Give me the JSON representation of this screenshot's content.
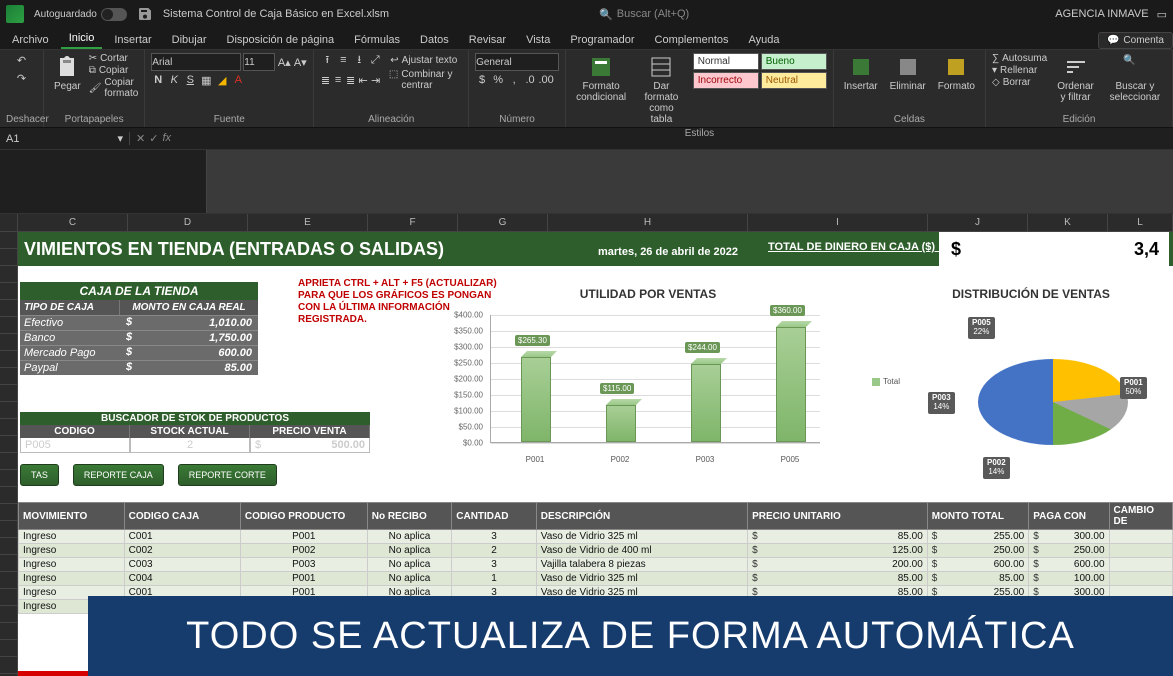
{
  "titlebar": {
    "autosave": "Autoguardado",
    "docname": "Sistema Control de Caja Básico en Excel.xlsm",
    "search": "Buscar (Alt+Q)",
    "account": "AGENCIA INMAVE"
  },
  "tabs": [
    "Archivo",
    "Inicio",
    "Insertar",
    "Dibujar",
    "Disposición de página",
    "Fórmulas",
    "Datos",
    "Revisar",
    "Vista",
    "Programador",
    "Complementos",
    "Ayuda"
  ],
  "active_tab": 1,
  "comments_btn": "Comenta",
  "ribbon": {
    "undo": "Deshacer",
    "paste": "Pegar",
    "cut": "Cortar",
    "copy": "Copiar",
    "fmtpaint": "Copiar formato",
    "clipboard": "Portapapeles",
    "font_name": "Arial",
    "font_size": "11",
    "font": "Fuente",
    "wrap": "Ajustar texto",
    "merge": "Combinar y centrar",
    "align": "Alineación",
    "numfmt": "General",
    "number": "Número",
    "condfmt": "Formato condicional",
    "astable": "Dar formato como tabla",
    "styles": "Estilos",
    "style_normal": "Normal",
    "style_bueno": "Bueno",
    "style_incor": "Incorrecto",
    "style_neutral": "Neutral",
    "insert": "Insertar",
    "delete": "Eliminar",
    "format": "Formato",
    "cells": "Celdas",
    "autosum": "Autosuma",
    "fill": "Rellenar",
    "clear": "Borrar",
    "sort": "Ordenar y filtrar",
    "find": "Buscar y seleccionar",
    "editing": "Edición"
  },
  "namebox": "A1",
  "cols": [
    "C",
    "D",
    "E",
    "F",
    "G",
    "H",
    "I",
    "J",
    "K",
    "L"
  ],
  "band": {
    "title": "VIMIENTOS EN TIENDA (ENTRADAS O SALIDAS)",
    "date": "martes, 26 de abril de 2022",
    "total_lbl": "TOTAL DE DINERO EN CAJA ($) :",
    "total_cur": "$",
    "total_val": "3,4"
  },
  "caja": {
    "title": "CAJA DE LA TIENDA",
    "h1": "TIPO DE CAJA",
    "h2": "MONTO EN CAJA REAL",
    "rows": [
      {
        "t": "Efectivo",
        "v": "1,010.00"
      },
      {
        "t": "Banco",
        "v": "1,750.00"
      },
      {
        "t": "Mercado Pago",
        "v": "600.00"
      },
      {
        "t": "Paypal",
        "v": "85.00"
      }
    ]
  },
  "rednote": "APRIETA CTRL + ALT + F5 (ACTUALIZAR) PARA QUE LOS GRÁFICOS ES PONGAN CON LA ÚLTIMA INFORMACIÓN REGISTRADA.",
  "busc": {
    "title": "BUSCADOR DE STOK DE PRODUCTOS",
    "h": [
      "CODIGO",
      "STOCK ACTUAL",
      "PRECIO VENTA"
    ],
    "code": "P005",
    "stock": "2",
    "price": "500.00"
  },
  "buttons": [
    "TAS",
    "REPORTE CAJA",
    "REPORTE CORTE"
  ],
  "table": {
    "headers": [
      "MOVIMIENTO",
      "CODIGO CAJA",
      "CODIGO PRODUCTO",
      "No RECIBO",
      "CANTIDAD",
      "DESCRIPCIÓN",
      "PRECIO UNITARIO",
      "MONTO TOTAL",
      "PAGA CON",
      "CAMBIO DE"
    ],
    "rows": [
      [
        "Ingreso",
        "C001",
        "P001",
        "No aplica",
        "3",
        "Vaso de Vidrio 325 ml",
        "85.00",
        "255.00",
        "300.00",
        ""
      ],
      [
        "Ingreso",
        "C002",
        "P002",
        "No aplica",
        "2",
        "Vaso de Vidrio de 400 ml",
        "125.00",
        "250.00",
        "250.00",
        ""
      ],
      [
        "Ingreso",
        "C003",
        "P003",
        "No aplica",
        "3",
        "Vajilla talabera 8 piezas",
        "200.00",
        "600.00",
        "600.00",
        ""
      ],
      [
        "Ingreso",
        "C004",
        "P001",
        "No aplica",
        "1",
        "Vaso de Vidrio 325 ml",
        "85.00",
        "85.00",
        "100.00",
        ""
      ],
      [
        "Ingreso",
        "C001",
        "P001",
        "No aplica",
        "3",
        "Vaso de Vidrio 325 ml",
        "85.00",
        "255.00",
        "300.00",
        ""
      ],
      [
        "Ingreso",
        "",
        "",
        "",
        "",
        "",
        "",
        "",
        "",
        ""
      ]
    ]
  },
  "banner": "TODO SE ACTUALIZA DE FORMA AUTOMÁTICA",
  "chart_data": [
    {
      "type": "bar",
      "title": "UTILIDAD POR VENTAS",
      "categories": [
        "P001",
        "P002",
        "P003",
        "P005"
      ],
      "values": [
        265.3,
        115.0,
        244.0,
        360.0
      ],
      "ylabel": "",
      "ylim": [
        0,
        400
      ],
      "yticks": [
        0,
        50,
        100,
        150,
        200,
        250,
        300,
        350,
        400
      ],
      "legend": [
        "Total"
      ]
    },
    {
      "type": "pie",
      "title": "DISTRIBUCIÓN DE VENTAS",
      "series": [
        {
          "name": "P001",
          "value": 50
        },
        {
          "name": "P002",
          "value": 14
        },
        {
          "name": "P003",
          "value": 14
        },
        {
          "name": "P005",
          "value": 22
        }
      ]
    }
  ]
}
